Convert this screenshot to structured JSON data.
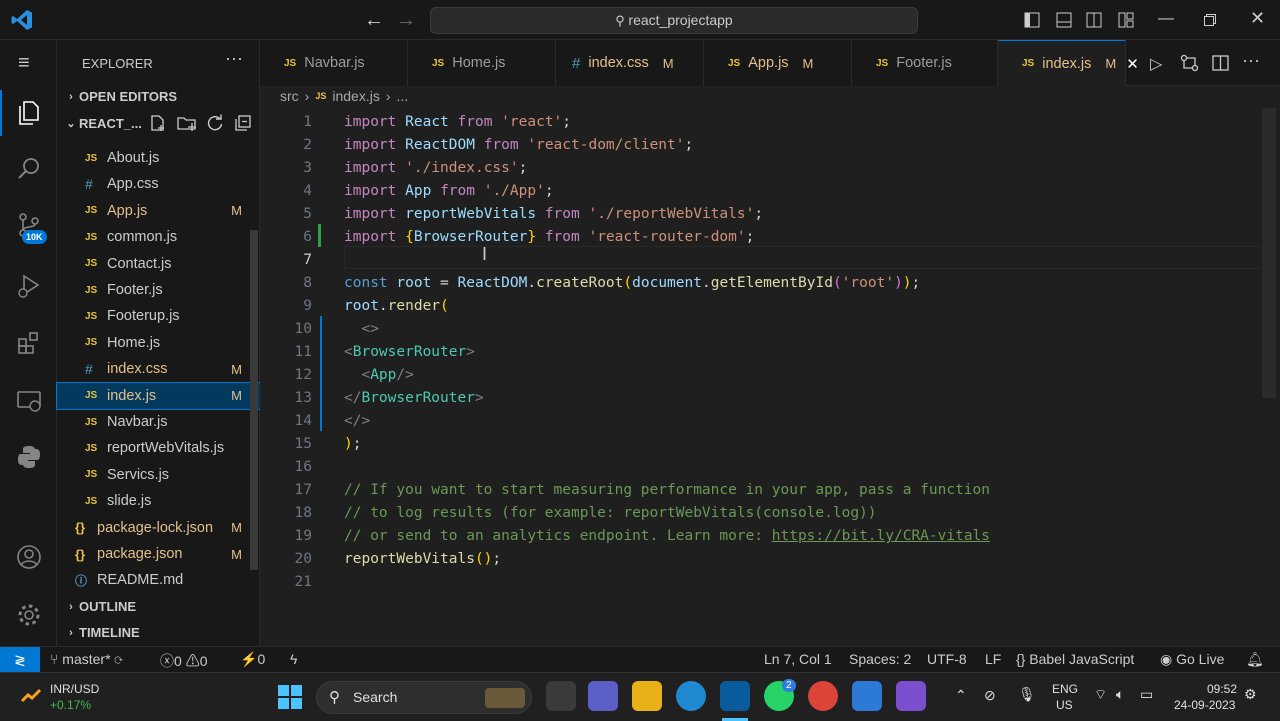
{
  "titlebar": {
    "search_text": "react_projectapp",
    "back_arrow": "←",
    "forward_arrow": "→"
  },
  "explorer": {
    "title": "EXPLORER",
    "open_editors": "OPEN EDITORS",
    "project": "REACT_...",
    "files": [
      {
        "name": "About.js",
        "icon": "JS",
        "badge": ""
      },
      {
        "name": "App.css",
        "icon": "#",
        "badge": ""
      },
      {
        "name": "App.js",
        "icon": "JS",
        "badge": "M"
      },
      {
        "name": "common.js",
        "icon": "JS",
        "badge": ""
      },
      {
        "name": "Contact.js",
        "icon": "JS",
        "badge": ""
      },
      {
        "name": "Footer.js",
        "icon": "JS",
        "badge": ""
      },
      {
        "name": "Footerup.js",
        "icon": "JS",
        "badge": ""
      },
      {
        "name": "Home.js",
        "icon": "JS",
        "badge": ""
      },
      {
        "name": "index.css",
        "icon": "#",
        "badge": "M"
      },
      {
        "name": "index.js",
        "icon": "JS",
        "badge": "M"
      },
      {
        "name": "Navbar.js",
        "icon": "JS",
        "badge": ""
      },
      {
        "name": "reportWebVitals.js",
        "icon": "JS",
        "badge": ""
      },
      {
        "name": "Servics.js",
        "icon": "JS",
        "badge": ""
      },
      {
        "name": "slide.js",
        "icon": "JS",
        "badge": ""
      },
      {
        "name": "package-lock.json",
        "icon": "{}",
        "badge": "M"
      },
      {
        "name": "package.json",
        "icon": "{}",
        "badge": "M"
      },
      {
        "name": "README.md",
        "icon": "ⓘ",
        "badge": ""
      }
    ],
    "outline": "OUTLINE",
    "timeline": "TIMELINE"
  },
  "tabs": [
    {
      "icon": "JS",
      "label": "Navbar.js",
      "badge": ""
    },
    {
      "icon": "JS",
      "label": "Home.js",
      "badge": ""
    },
    {
      "icon": "#",
      "label": "index.css",
      "badge": "M"
    },
    {
      "icon": "JS",
      "label": "App.js",
      "badge": "M"
    },
    {
      "icon": "JS",
      "label": "Footer.js",
      "badge": ""
    },
    {
      "icon": "JS",
      "label": "index.js",
      "badge": "M"
    }
  ],
  "breadcrumb": {
    "folder": "src",
    "icon": "JS",
    "file": "index.js",
    "more": "..."
  },
  "editor": {
    "current_line": 7
  },
  "status": {
    "branch": "master*",
    "errors": "0",
    "warnings": "0",
    "ports": "0",
    "position": "Ln 7, Col 1",
    "spaces": "Spaces: 2",
    "encoding": "UTF-8",
    "eol": "LF",
    "language": "Babel JavaScript",
    "golive": "Go Live"
  },
  "activity": {
    "badge": "10K"
  },
  "taskbar": {
    "stock_name": "INR/USD",
    "stock_change": "+0.17%",
    "search": "Search",
    "lang1": "ENG",
    "lang2": "US",
    "time": "09:52",
    "date": "24-09-2023",
    "whatsapp_badge": "2"
  },
  "colors": {
    "accent": "#0078d4",
    "modified": "#e2c08d",
    "js_icon": "#e8c442",
    "css_icon": "#519aba"
  }
}
